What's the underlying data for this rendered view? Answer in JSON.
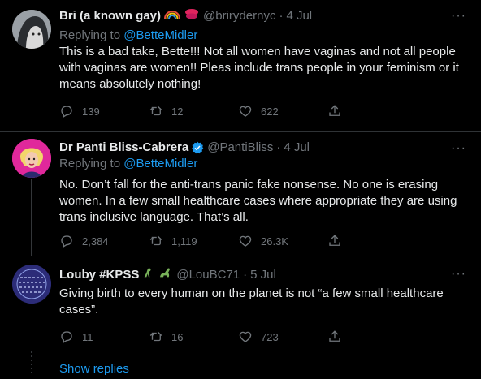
{
  "tweets": [
    {
      "name": "Bri (a known gay)",
      "emojis": [
        "rainbow",
        "kiss-mark"
      ],
      "handle": "@brirydernyc",
      "time": "4 Jul",
      "replying_label": "Replying to",
      "replying_to": "@BetteMidler",
      "text": "This is a bad take, Bette!!! Not all women have vaginas and not all people with vaginas are women!! Pleas include trans people in your feminism or it means absolutely nothing!",
      "replies": "139",
      "retweets": "12",
      "likes": "622"
    },
    {
      "name": "Dr Panti Bliss-Cabrera",
      "verified": true,
      "handle": "@PantiBliss",
      "time": "4 Jul",
      "replying_label": "Replying to",
      "replying_to": "@BetteMidler",
      "text": "No. Don’t fall for the anti-trans panic fake nonsense. No one is erasing women. In a few small healthcare cases where appropriate they are using trans inclusive language. That’s all.",
      "replies": "2,384",
      "retweets": "1,119",
      "likes": "26.3K"
    },
    {
      "name": "Louby #KPSS",
      "emojis": [
        "dinosaur",
        "dinosaur"
      ],
      "handle": "@LouBC71",
      "time": "5 Jul",
      "text": "Giving birth to every human on the planet is not “a few small healthcare cases”.",
      "replies": "11",
      "retweets": "16",
      "likes": "723"
    }
  ],
  "show_replies": "Show replies",
  "dot": "·",
  "more_glyph": "···",
  "colors": {
    "background": "#000000",
    "text": "#e7e9ea",
    "muted": "#71767b",
    "link": "#1d9bf0",
    "divider": "#2f3336"
  },
  "icons": [
    "reply-icon",
    "retweet-icon",
    "like-icon",
    "share-icon",
    "verified-badge-icon",
    "more-icon"
  ]
}
